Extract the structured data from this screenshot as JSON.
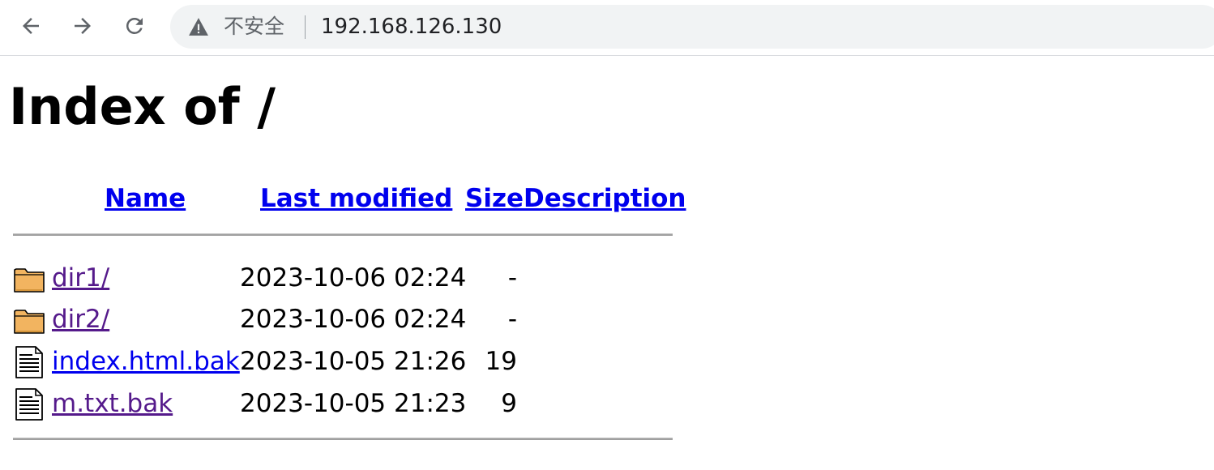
{
  "browser": {
    "security_label": "不安全",
    "url": "192.168.126.130",
    "back_icon": "back-arrow-icon",
    "forward_icon": "forward-arrow-icon",
    "reload_icon": "reload-icon",
    "warning_icon": "warning-triangle-icon"
  },
  "page": {
    "title": "Index of /"
  },
  "columns": {
    "name": "Name",
    "last_modified": "Last modified",
    "size": "Size",
    "description": "Description"
  },
  "rows": [
    {
      "name": "dir1/",
      "modified": "2023-10-06 02:24",
      "size": "-",
      "icon": "folder-icon",
      "visited": true
    },
    {
      "name": "dir2/",
      "modified": "2023-10-06 02:24",
      "size": "-",
      "icon": "folder-icon",
      "visited": true
    },
    {
      "name": "index.html.bak",
      "modified": "2023-10-05 21:26",
      "size": "19",
      "icon": "text-file-icon",
      "visited": false
    },
    {
      "name": "m.txt.bak",
      "modified": "2023-10-05 21:23",
      "size": "9",
      "icon": "text-file-icon",
      "visited": true
    }
  ],
  "colors": {
    "link": "#0000ee",
    "visited_link": "#551a8b",
    "omnibox_bg": "#f1f3f4"
  }
}
